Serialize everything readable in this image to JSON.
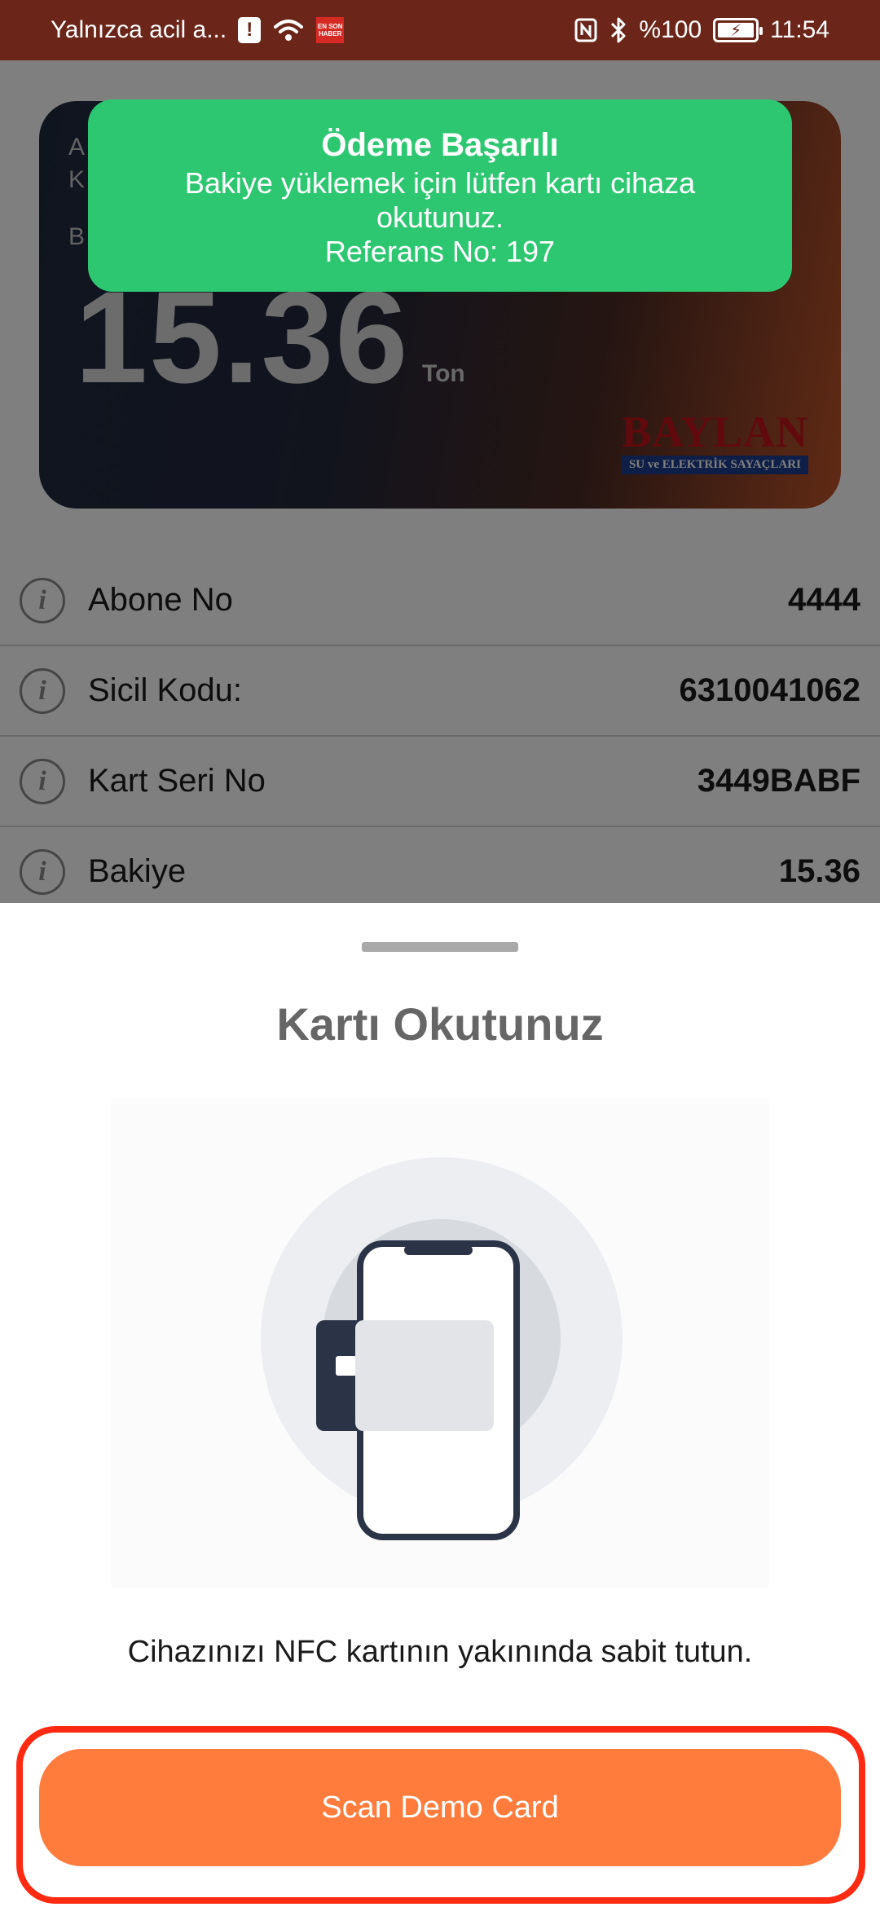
{
  "status_bar": {
    "carrier": "Yalnızca acil a...",
    "news_badge": "EN SON HABER",
    "battery": "%100",
    "time": "11:54"
  },
  "card": {
    "label_1": "A",
    "label_2": "K",
    "label_3": "B",
    "balance": "15.36",
    "unit": "Ton",
    "brand_name": "BAYLAN",
    "brand_sub": "SU ve ELEKTRİK SAYAÇLARI"
  },
  "toast": {
    "title": "Ödeme Başarılı",
    "message": "Bakiye yüklemek için lütfen kartı cihaza okutunuz.",
    "reference": "Referans No: 197",
    "color": "#2ec771"
  },
  "rows": [
    {
      "label": "Abone No",
      "value": "4444"
    },
    {
      "label": "Sicil Kodu:",
      "value": "6310041062"
    },
    {
      "label": "Kart Seri No",
      "value": "3449BABF"
    },
    {
      "label": "Bakiye",
      "value": "15.36"
    }
  ],
  "sheet": {
    "title": "Kartı Okutunuz",
    "hint": "Cihazınızı NFC kartının yakınında sabit tutun.",
    "scan_button": "Scan Demo Card",
    "accent_color": "#ff7c3d",
    "highlight_color": "#ff2a12"
  },
  "icons": {
    "info": "info-icon",
    "illustration": "nfc-phone-card-illustration"
  }
}
